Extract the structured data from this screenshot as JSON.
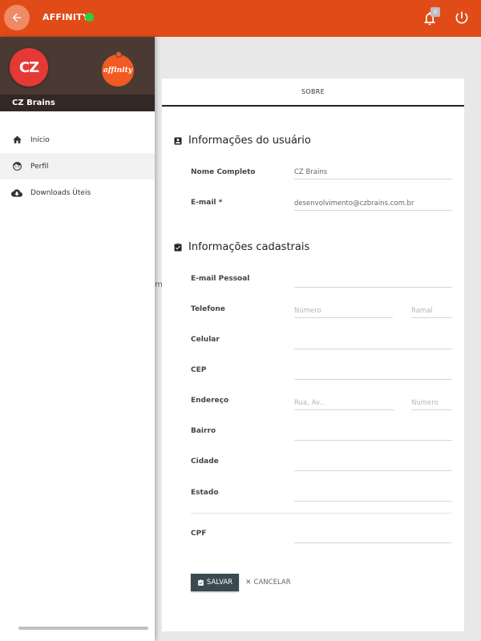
{
  "header": {
    "app_title": "AFFINITY",
    "status_color": "#2ecc40",
    "notification_count": "0",
    "accent_color": "#e04b17"
  },
  "sidebar": {
    "profile_name": "CZ Brains",
    "cz_logo_text": "CZ",
    "affinity_logo_text": "affinity",
    "items": [
      {
        "label": "Início",
        "icon": "home-icon"
      },
      {
        "label": "Perfil",
        "icon": "face-icon"
      },
      {
        "label": "Downloads Úteis",
        "icon": "cloud-download-icon"
      }
    ]
  },
  "main": {
    "stray_char": "m",
    "tab": "SOBRE",
    "user_section": {
      "title": "Informações do usuário",
      "full_name_label": "Nome Completo",
      "full_name_value": "CZ Brains",
      "email_label": "E-mail *",
      "email_value": "desenvolvimento@czbrains.com.br"
    },
    "registration_section": {
      "title": "Informações cadastrais",
      "personal_email_label": "E-mail Pessoal",
      "phone_label": "Telefone",
      "phone_placeholder": "Número",
      "extension_placeholder": "Ramal",
      "mobile_label": "Celular",
      "cep_label": "CEP",
      "address_label": "Endereço",
      "address_placeholder": "Rua, Av...",
      "address_number_placeholder": "Número",
      "district_label": "Bairro",
      "city_label": "Cidade",
      "state_label": "Estado",
      "cpf_label": "CPF"
    },
    "actions": {
      "save_label": "SALVAR",
      "cancel_label": "CANCELAR"
    }
  }
}
